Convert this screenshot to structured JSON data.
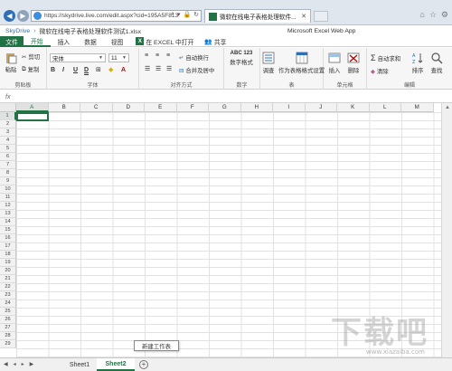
{
  "browser": {
    "url": "https://skydrive.live.com/edit.aspx?cid=195A5F813",
    "tab_title": "微软在线电子表格处理软件...",
    "icons": [
      "back-icon",
      "forward-icon",
      "search-icon",
      "refresh-icon",
      "lock-icon",
      "close-icon",
      "home-icon",
      "star-icon",
      "gear-icon"
    ]
  },
  "app": {
    "breadcrumb_root": "SkyDrive",
    "breadcrumb_sep": "›",
    "document_name": "微软在线电子表格处理软件测试1.xlsx",
    "app_name": "Microsoft Excel Web App",
    "accent": "#217346"
  },
  "menu": {
    "file": "文件",
    "items": [
      "开始",
      "插入",
      "数据",
      "视图"
    ],
    "active_index": 0,
    "open_in_excel": "在 EXCEL 中打开",
    "share": "共享"
  },
  "ribbon": {
    "clipboard": {
      "paste": "粘贴",
      "cut": "剪切",
      "copy": "复制",
      "label": "剪贴板"
    },
    "font": {
      "name": "宋体",
      "size": "11",
      "bold": "B",
      "italic": "I",
      "underline": "U",
      "double_underline": "D",
      "label": "字体"
    },
    "alignment": {
      "wrap": "自动换行",
      "merge": "合并及居中",
      "label": "对齐方式"
    },
    "number": {
      "format": "数字格式",
      "sample": "ABC 123",
      "label": "数字"
    },
    "tables": {
      "survey": "调查",
      "as_table": "作为表格格式设置",
      "label": "表"
    },
    "cells": {
      "insert": "插入",
      "delete": "删除",
      "label": "单元格"
    },
    "editing": {
      "autosum": "自动求和",
      "clear": "清除",
      "sort": "排序",
      "find": "查找",
      "label": "编辑"
    }
  },
  "formula_bar": {
    "fx": "fx",
    "value": ""
  },
  "grid": {
    "columns": [
      "A",
      "B",
      "C",
      "D",
      "E",
      "F",
      "G",
      "H",
      "I",
      "J",
      "K",
      "L",
      "M"
    ],
    "rows": [
      "1",
      "2",
      "3",
      "4",
      "5",
      "6",
      "7",
      "8",
      "9",
      "10",
      "11",
      "12",
      "13",
      "14",
      "15",
      "16",
      "17",
      "18",
      "19",
      "20",
      "21",
      "22",
      "23",
      "24",
      "25",
      "26",
      "27",
      "28",
      "29"
    ],
    "active_cell": "A1"
  },
  "tooltip": "新建工作表",
  "sheets": {
    "tabs": [
      "Sheet1",
      "Sheet2"
    ],
    "active_index": 1
  },
  "watermark": {
    "logo": "下载吧",
    "url": "www.xiazaiba.com"
  }
}
